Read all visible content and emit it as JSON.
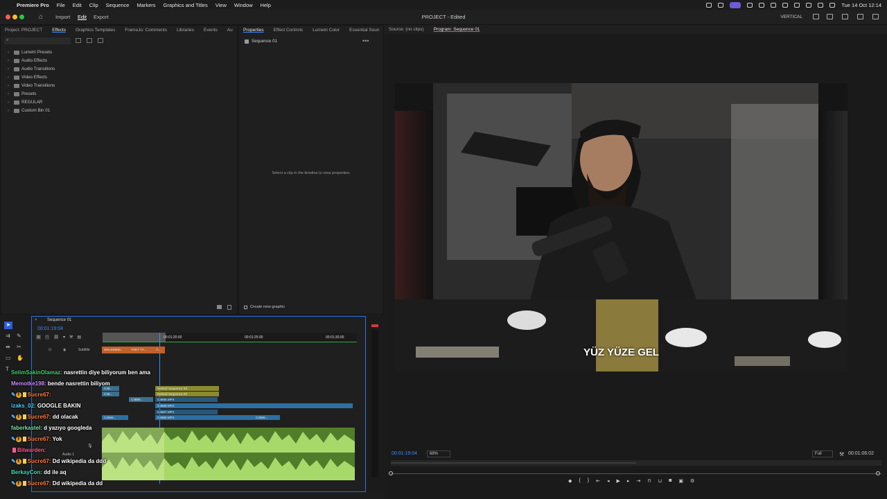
{
  "menubar": {
    "app": "Premiere Pro",
    "items": [
      "File",
      "Edit",
      "Clip",
      "Sequence",
      "Markers",
      "Graphics and Titles",
      "View",
      "Window",
      "Help"
    ],
    "datetime": "Tue 14 Oct  12:14"
  },
  "app_header": {
    "tabs": [
      "Import",
      "Edit",
      "Export"
    ],
    "active_tab": "Edit",
    "project_title": "PROJECT - Edited",
    "workspace_label": "VERTICAL"
  },
  "effects_panel": {
    "tabs": [
      "Project: PROJECT",
      "Effects",
      "Graphics Templates",
      "FrameJo: Comments",
      "Libraries",
      "Events",
      "Au"
    ],
    "active_tab": "Effects",
    "tree": [
      "Lumetri Presets",
      "Audio Effects",
      "Audio Transitions",
      "Video Effects",
      "Video Transitions",
      "Presets",
      "REGULAR",
      "Custom Bin 01"
    ]
  },
  "properties_panel": {
    "tabs": [
      "Properties",
      "Effect Controls",
      "Lumetri Color",
      "Essential Soun"
    ],
    "active_tab": "Properties",
    "sequence": "Sequence 01",
    "empty_message": "Select a clip in the timeline to view properties.",
    "create_graphic": "Create new graphic"
  },
  "program_monitor": {
    "tabs": [
      "Source: (no clips)",
      "Program: Sequence 01"
    ],
    "active_tab": "Program: Sequence 01",
    "caption": "YÜZ YÜZE GEL",
    "timecode": "00:01:19:04",
    "zoom": "68%",
    "quality": "Full",
    "duration": "00:01:06:02",
    "playhead_fraction": 0.5
  },
  "timeline": {
    "tab": "Sequence 01",
    "timecode": "00:01:19:04",
    "ruler": [
      "00:01:20:00",
      "00:01:25:00",
      "00:01:30:00"
    ],
    "subtitle_track": "Subtitle",
    "subtitle_clips": [
      "SIKLEMEM...",
      "THEY TA...",
      "Y..."
    ],
    "nested": [
      "Nested Sequence 03",
      "Nested Sequence 03"
    ],
    "clips": [
      "C46...",
      "C46...",
      "C4686...",
      "C4686.MP4",
      "C4686.MP4",
      "C4687.MP4",
      "C4686.MP4",
      "C4686...",
      "C4686..."
    ],
    "audio_track": "Audio 1"
  },
  "chat": [
    {
      "user": "SelimSakinOlamaz:",
      "msg": "nasrettin diye biliyorum ben ama",
      "color": "#41d36a",
      "badges": ""
    },
    {
      "user": "Memotke198:",
      "msg": "bende nasrettin biliyom",
      "color": "#c98cff",
      "badges": ""
    },
    {
      "user": "Sucre67:",
      "msg": "",
      "color": "#ff7a3a",
      "badges": "mod"
    },
    {
      "user": "izaks_02:",
      "msg": "GOOGLE BAKIN",
      "color": "#43d3ff",
      "badges": ""
    },
    {
      "user": "Sucre67:",
      "msg": "dd olacak",
      "color": "#ff7a3a",
      "badges": "mod"
    },
    {
      "user": "faberkastel:",
      "msg": "d yazıyo googleda",
      "color": "#7be3a8",
      "badges": ""
    },
    {
      "user": "Sucre67:",
      "msg": "Yok",
      "color": "#ff7a3a",
      "badges": "mod"
    },
    {
      "user": "Bitwarden:",
      "msg": "",
      "color": "#ff5d8f",
      "badges": "sub"
    },
    {
      "user": "Sucre67:",
      "msg": "Dd wikipedia da ddd",
      "color": "#ff7a3a",
      "badges": "mod"
    },
    {
      "user": "BerkayCon:",
      "msg": "dd ile aq",
      "color": "#41e0b4",
      "badges": ""
    },
    {
      "user": "Sucre67:",
      "msg": "Dd wikipedia da dd",
      "color": "#ff7a3a",
      "badges": "mod"
    }
  ],
  "icons": [
    "apple-icon",
    "home-icon",
    "search-icon",
    "play-icon",
    "step-back-icon",
    "step-forward-icon",
    "marker-icon",
    "camera-icon",
    "settings-icon",
    "wrench-icon",
    "eye-icon",
    "lock-icon",
    "mic-icon",
    "selection-tool-icon",
    "razor-tool-icon",
    "hand-tool-icon",
    "text-tool-icon"
  ]
}
